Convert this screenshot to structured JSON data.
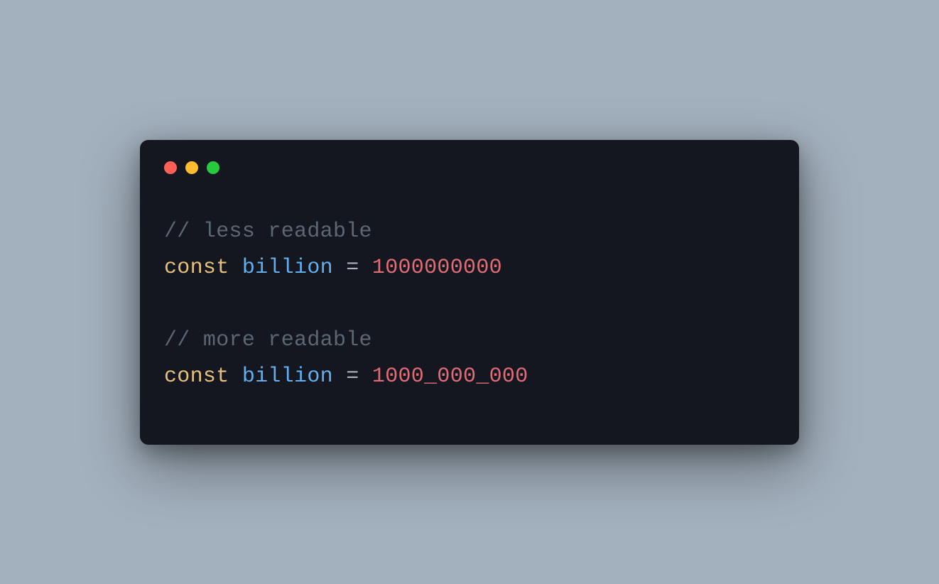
{
  "code": {
    "line1": {
      "comment": "// less readable"
    },
    "line2": {
      "keyword": "const",
      "space1": " ",
      "ident": "billion",
      "space2": " ",
      "op": "=",
      "space3": " ",
      "number": "1000000000"
    },
    "line3": {
      "comment": "// more readable"
    },
    "line4": {
      "keyword": "const",
      "space1": " ",
      "ident": "billion",
      "space2": " ",
      "op": "=",
      "space3": " ",
      "number": "1000_000_000"
    }
  },
  "colors": {
    "bg": "#a3b0bd",
    "window": "#151720",
    "comment": "#5c6773",
    "keyword": "#e6c07b",
    "ident": "#61afef",
    "op": "#abb2bf",
    "number": "#e06c75",
    "red": "#ff5f56",
    "yellow": "#ffbd2e",
    "green": "#27c93f"
  }
}
